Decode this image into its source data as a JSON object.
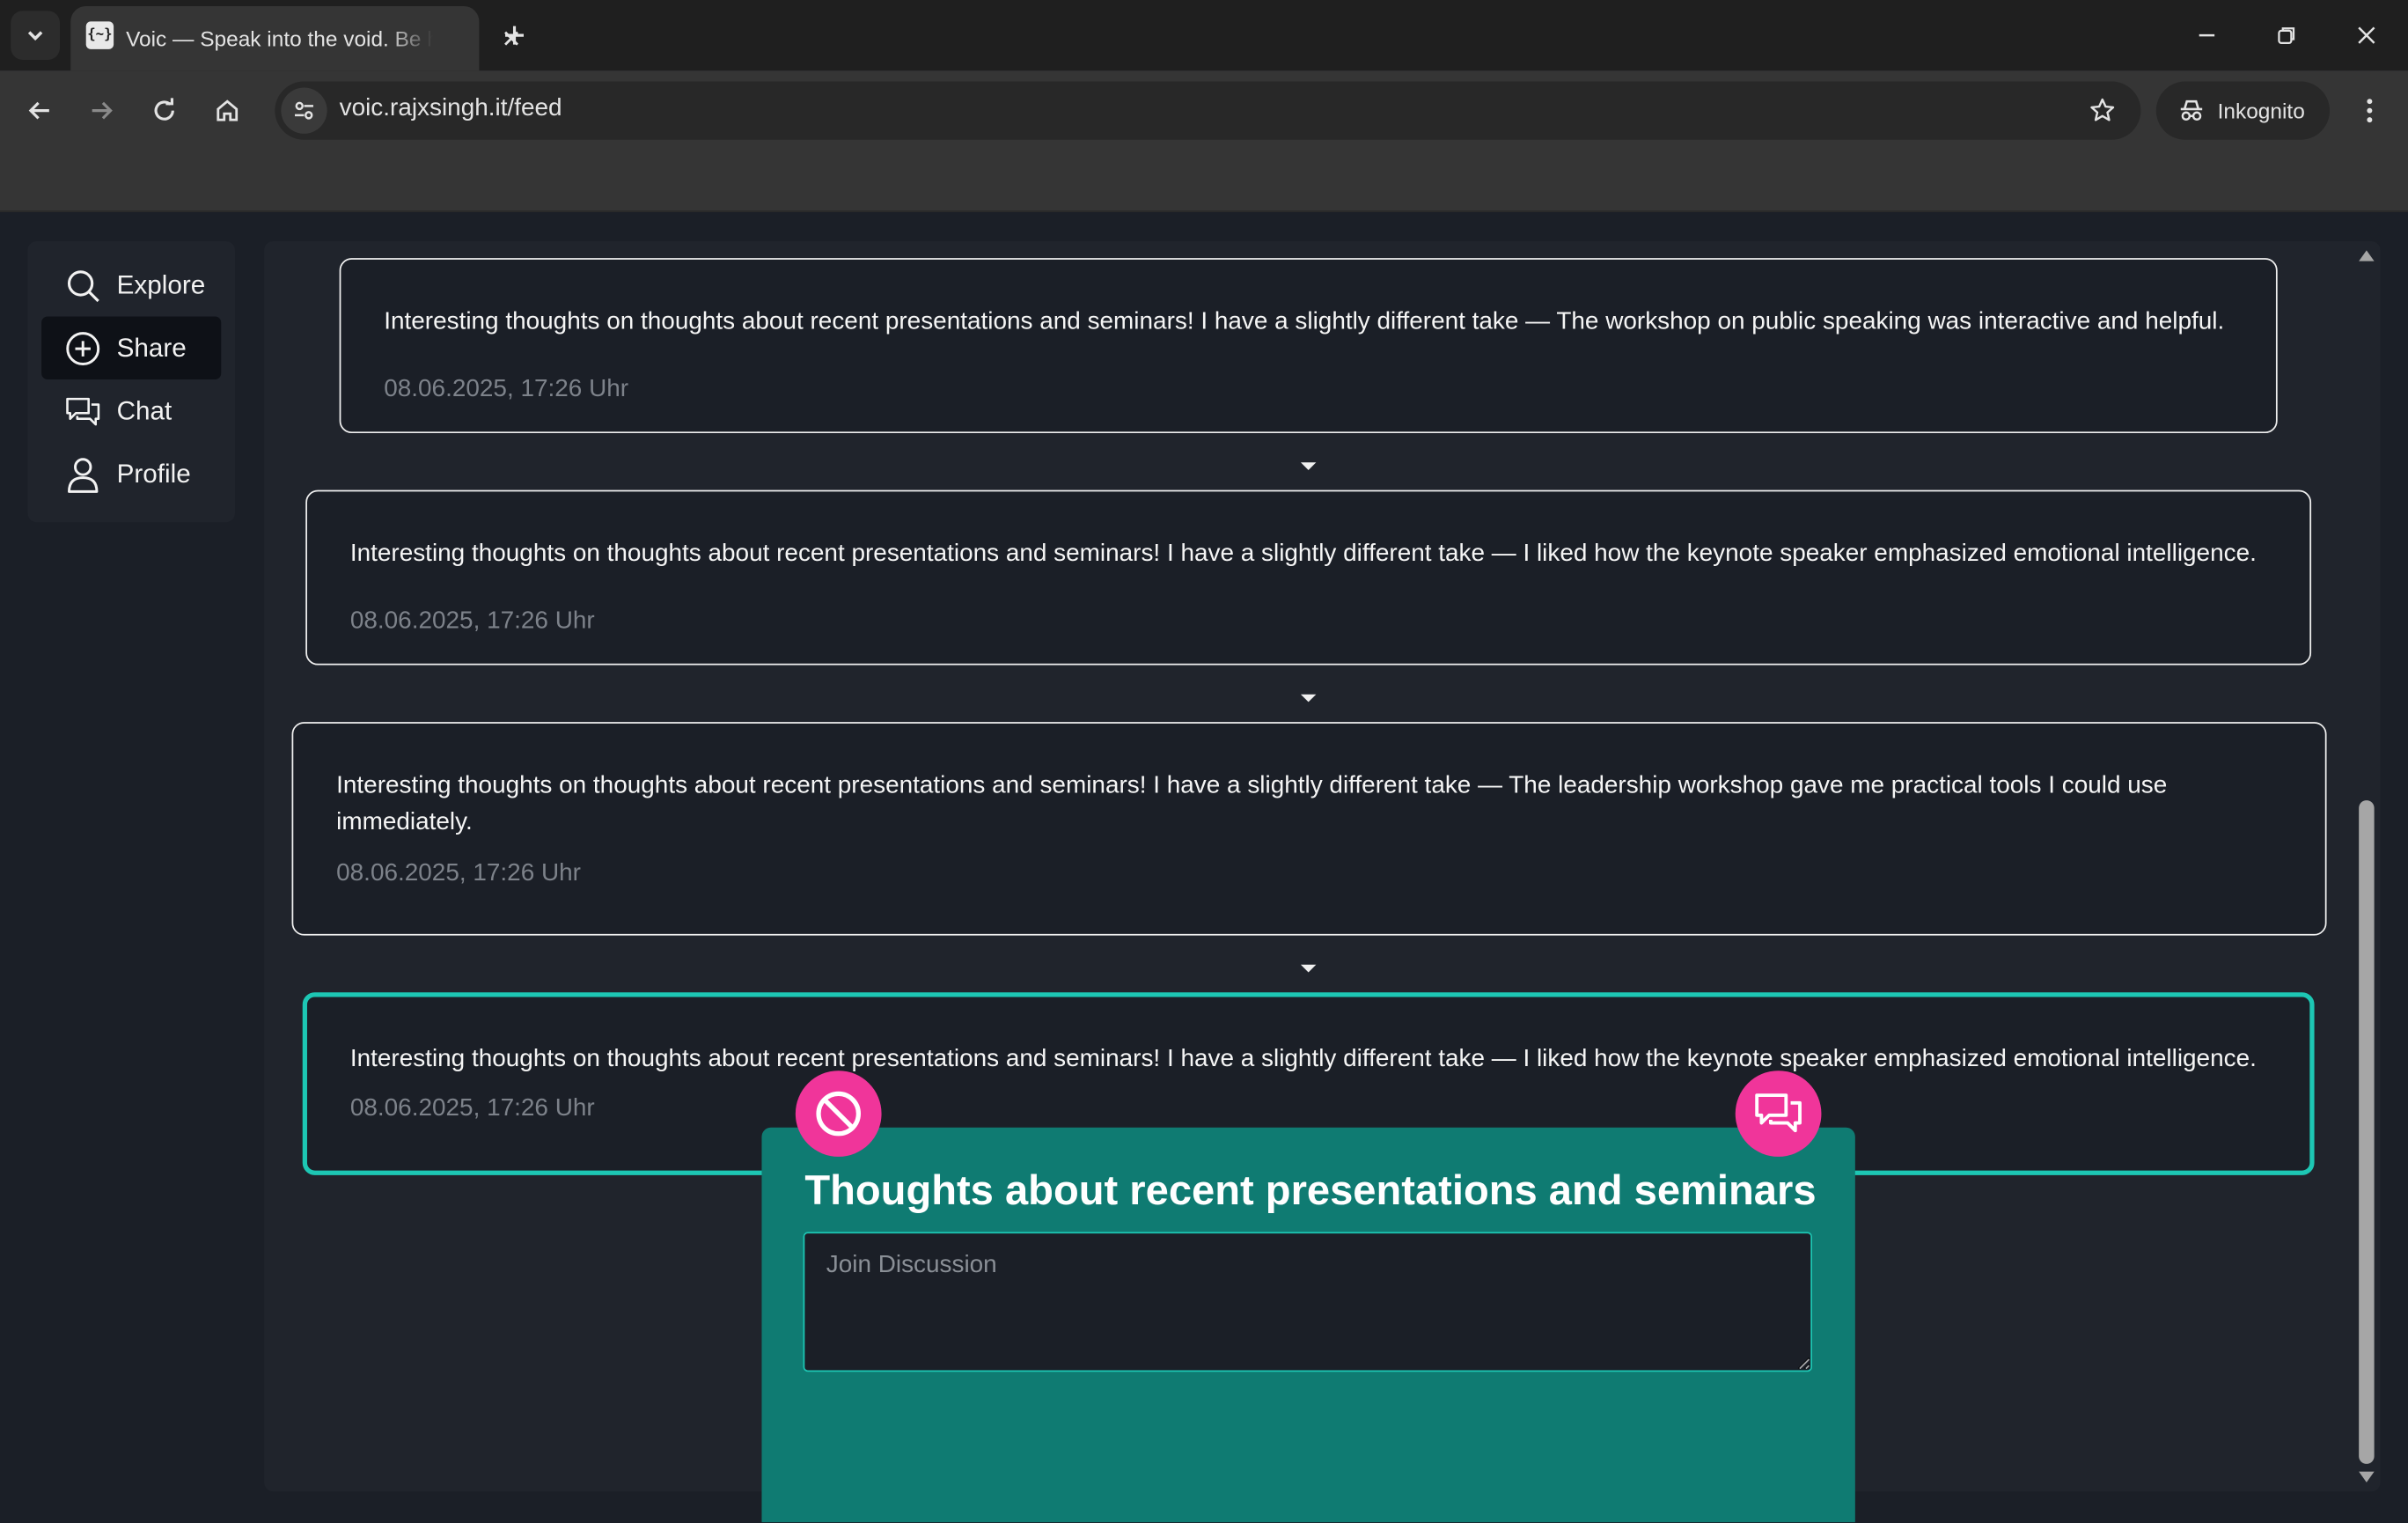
{
  "browser": {
    "tab_title": "Voic — Speak into the void. Be heard.",
    "url": "voic.rajxsingh.it/feed",
    "incognito_label": "Inkognito",
    "favicon_text": "{~}"
  },
  "sidebar": {
    "items": [
      {
        "label": "Explore",
        "icon": "search-icon"
      },
      {
        "label": "Share",
        "icon": "plus-circle-icon"
      },
      {
        "label": "Chat",
        "icon": "chat-bubbles-icon"
      },
      {
        "label": "Profile",
        "icon": "user-icon"
      }
    ],
    "active": "Share"
  },
  "feed": {
    "posts": [
      {
        "text": "Interesting thoughts on thoughts about recent presentations and seminars! I have a slightly different take — The workshop on public speaking was interactive and helpful.",
        "time": "08.06.2025, 17:26 Uhr"
      },
      {
        "text": "Interesting thoughts on thoughts about recent presentations and seminars! I have a slightly different take — I liked how the keynote speaker emphasized emotional intelligence.",
        "time": "08.06.2025, 17:26 Uhr"
      },
      {
        "text": "Interesting thoughts on thoughts about recent presentations and seminars! I have a slightly different take — The leadership workshop gave me practical tools I could use immediately.",
        "time": "08.06.2025, 17:26 Uhr"
      },
      {
        "text": "Interesting thoughts on thoughts about recent presentations and seminars! I have a slightly different take — I liked how the keynote speaker emphasized emotional intelligence.",
        "time": "08.06.2025, 17:26 Uhr"
      }
    ]
  },
  "panel": {
    "title": "Thoughts about recent presentations and seminars",
    "input_placeholder": "Join Discussion",
    "input_value": ""
  },
  "colors": {
    "accent_teal": "#1dc7b4",
    "panel_bg": "#0f7b72",
    "pink": "#f0359a",
    "page_bg": "#1b1f27"
  }
}
